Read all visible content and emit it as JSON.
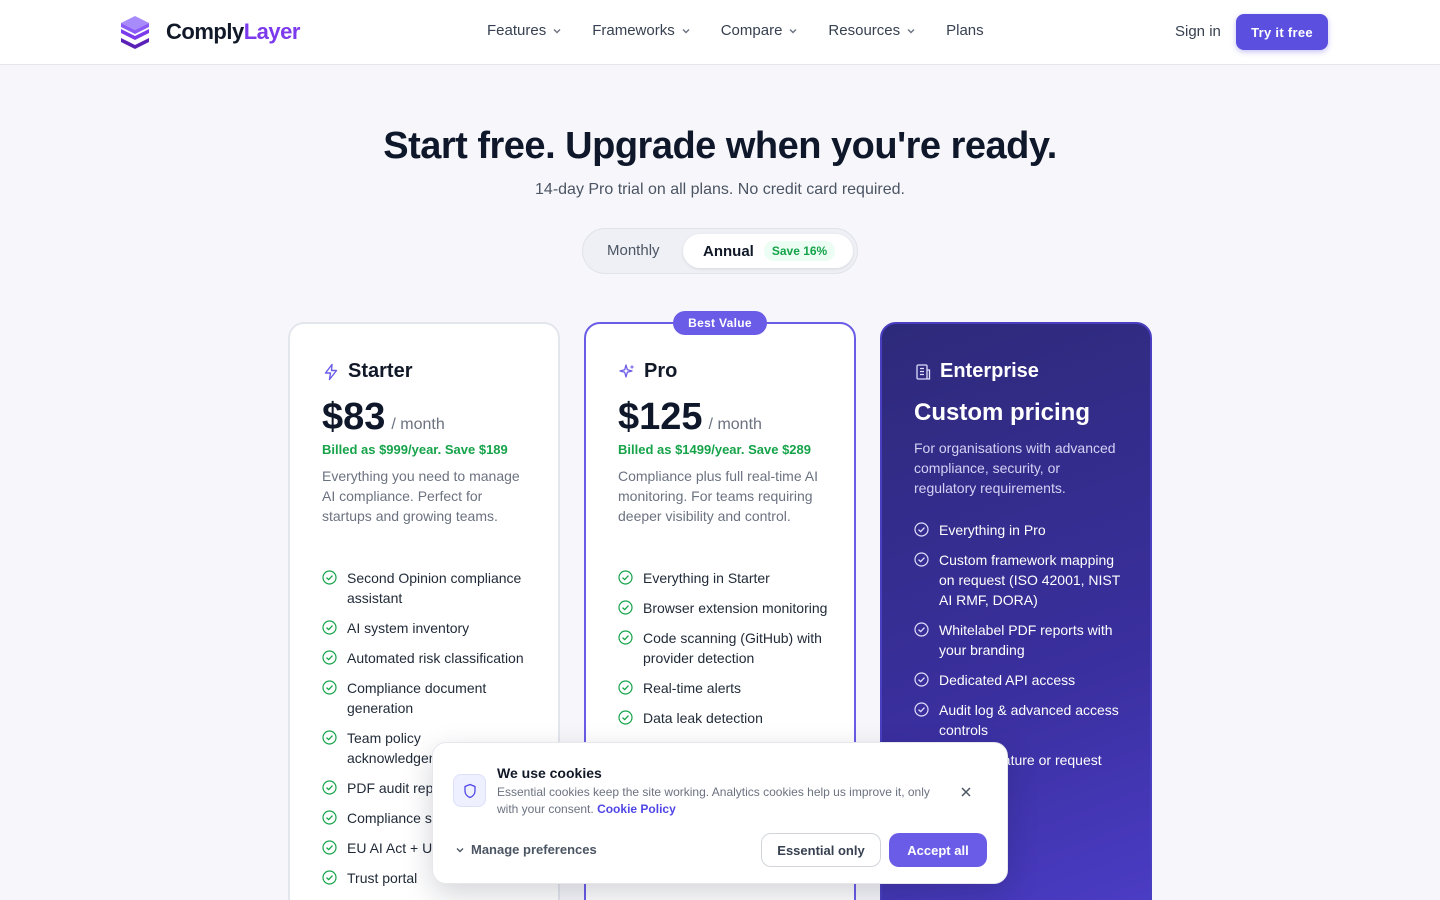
{
  "brand": {
    "part1": "Comply",
    "part2": "Layer"
  },
  "nav": {
    "items": [
      "Features",
      "Frameworks",
      "Compare",
      "Resources"
    ],
    "plans": "Plans",
    "signin": "Sign in",
    "cta": "Try it free"
  },
  "hero": {
    "title": "Start free. Upgrade when you're ready.",
    "subtitle": "14-day Pro trial on all plans. No credit card required."
  },
  "billing_toggle": {
    "monthly": "Monthly",
    "annual": "Annual",
    "save": "Save 16%",
    "selected": "Annual"
  },
  "plans": {
    "starter": {
      "name": "Starter",
      "price": "$83",
      "per": "/ month",
      "billed": "Billed as $999/year. Save $189",
      "description": "Everything you need to manage AI compliance. Perfect for startups and growing teams.",
      "features": [
        "Second Opinion compliance assistant",
        "AI system inventory",
        "Automated risk classification",
        "Compliance document generation",
        "Team policy acknowledgement",
        "PDF audit reports",
        "Compliance score",
        "EU AI Act + US",
        "Trust portal"
      ]
    },
    "pro": {
      "badge": "Best Value",
      "name": "Pro",
      "price": "$125",
      "per": "/ month",
      "billed": "Billed as $1499/year. Save $289",
      "description": "Compliance plus full real-time AI monitoring. For teams requiring deeper visibility and control.",
      "features": [
        "Everything in Starter",
        "Browser extension monitoring",
        "Code scanning (GitHub) with provider detection",
        "Real-time alerts",
        "Data leak detection"
      ]
    },
    "enterprise": {
      "name": "Enterprise",
      "price": "Custom pricing",
      "description": "For organisations with advanced compliance, security, or regulatory requirements.",
      "features": [
        "Everything in Pro",
        "Custom framework mapping on request (ISO 42001, NIST AI RMF, DORA)",
        "Whitelabel PDF reports with your branding",
        "Dedicated API access",
        "Audit log & advanced access controls",
        "Custom feature or request"
      ]
    }
  },
  "cookie": {
    "title": "We use cookies",
    "text": "Essential cookies keep the site working. Analytics cookies help us improve it, only with your consent.",
    "link": "Cookie Policy",
    "manage": "Manage preferences",
    "essential": "Essential only",
    "accept": "Accept all"
  },
  "colors": {
    "accent": "#6b5ce7",
    "success": "#16a34a",
    "enterprise_bg": "#2e2a7a"
  }
}
